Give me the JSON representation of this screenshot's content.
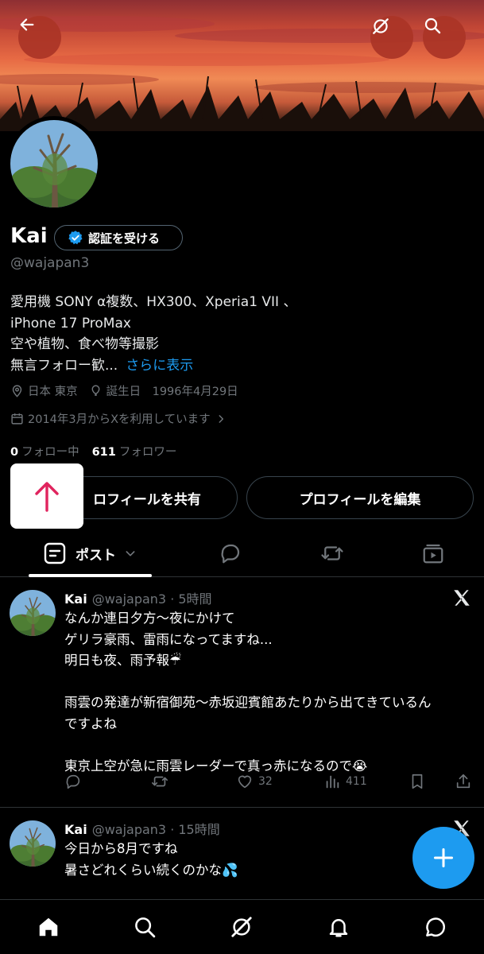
{
  "profile": {
    "name": "Kai",
    "verify_label": "認証を受ける",
    "handle": "@wajapan3",
    "bio_lines": [
      "愛用機 SONY α複数、HX300、Xperia1 VII 、",
      "iPhone 17 ProMax",
      "空や植物、食べ物等撮影",
      "無言フォロー歓..."
    ],
    "bio_more": "さらに表示",
    "location": "日本 東京",
    "birthday": "誕生日　1996年4月29日",
    "joined": "2014年3月からXを利用しています",
    "following_count": "0",
    "following_label": "フォロー中",
    "followers_count": "611",
    "followers_label": "フォロワー",
    "share_label": "ロフィールを共有",
    "edit_label": "プロフィールを編集"
  },
  "tabs": {
    "posts_label": "ポスト"
  },
  "posts": [
    {
      "name": "Kai",
      "handle": "@wajapan3",
      "time": "· 5時間",
      "text": "なんか連日夕方〜夜にかけて\nゲリラ豪雨、雷雨になってますね...\n明日も夜、雨予報☔\n\n雨雲の発達が新宿御苑〜赤坂迎賓館あたりから出てきているん\nですよね\n\n東京上空が急に雨雲レーダーで真っ赤になるので😭",
      "likes": "32",
      "views": "411"
    },
    {
      "name": "Kai",
      "handle": "@wajapan3",
      "time": "· 15時間",
      "text": "今日から8月ですね\n暑さどれくらい続くのかな💦"
    }
  ],
  "colors": {
    "accent": "#1d9bf0",
    "background": "#000000",
    "secondary_text": "#71767b",
    "scroll_arrow": "#e0245e"
  }
}
